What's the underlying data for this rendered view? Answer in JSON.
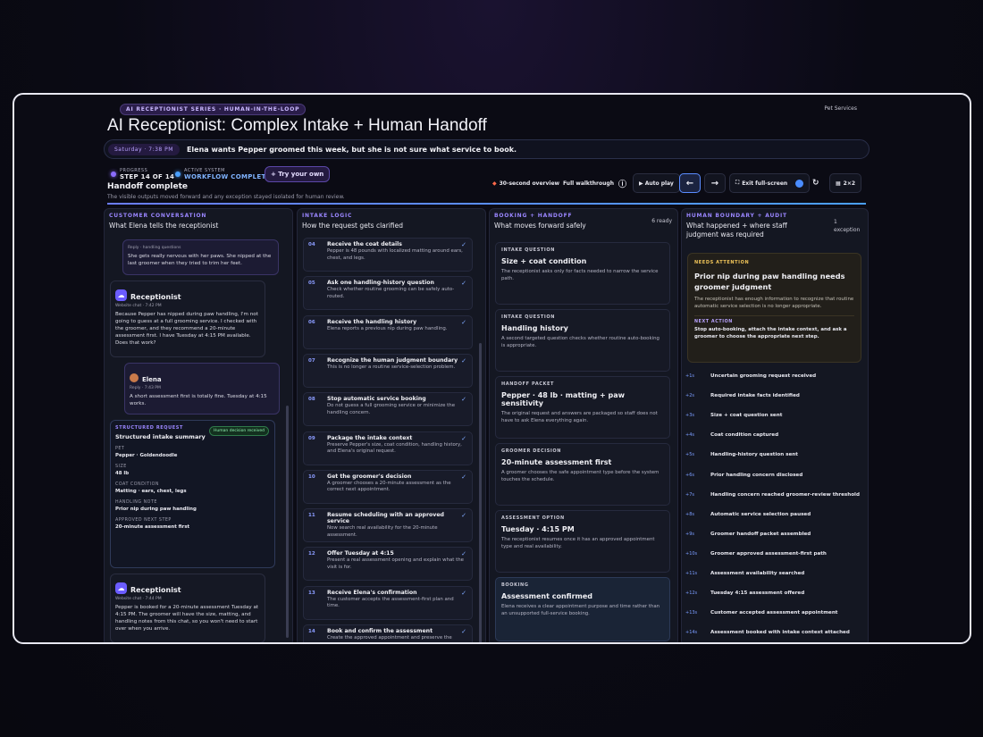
{
  "header": {
    "series": "AI RECEPTIONIST SERIES · HUMAN-IN-THE-LOOP",
    "category": "Pet Services",
    "title": "AI Receptionist: Complex Intake + Human Handoff",
    "scenario_time": "Saturday · 7:38 PM",
    "scenario_text": "Elena wants Pepper groomed this week, but she is not sure what service to book."
  },
  "status": {
    "progress_label": "PROGRESS",
    "progress_value": "STEP 14 OF 14",
    "system_label": "ACTIVE SYSTEM",
    "system_value": "WORKFLOW COMPLETE",
    "try_label": "+ Try your own",
    "headline": "Handoff complete",
    "subline": "The visible outputs moved forward and any exception stayed isolated for human review.",
    "progress_fraction": 1.0
  },
  "toolbar": {
    "overview": "30-second overview",
    "walkthrough": "Full walkthrough",
    "info_icon": "ⓘ",
    "autoplay": "▶ Auto play",
    "prev": "←",
    "next": "→",
    "fullscreen": "Exit full-screen",
    "grid": "2×2"
  },
  "conversation": {
    "heading": "CUSTOMER CONVERSATION",
    "subheading": "What Elena tells the receptionist",
    "msg1_meta": "Reply · handling questions",
    "msg1_text": "She gets really nervous with her paws. She nipped at the last groomer when they tried to trim her feet.",
    "msg2_name": "Receptionist",
    "msg2_meta": "Website chat · 7:42 PM",
    "msg2_text": "Because Pepper has nipped during paw handling, I'm not going to guess at a full grooming service. I checked with the groomer, and they recommend a 20-minute assessment first. I have Tuesday at 4:15 PM available. Does that work?",
    "msg3_name": "Elena",
    "msg3_meta": "Reply · 7:43 PM",
    "msg3_text": "A short assessment first is totally fine. Tuesday at 4:15 works.",
    "sr_label": "STRUCTURED REQUEST",
    "sr_title": "Structured intake summary",
    "sr_badge": "Human decision received",
    "sr_fields": [
      {
        "k": "PET",
        "v": "Pepper · Goldendoodle"
      },
      {
        "k": "SIZE",
        "v": "48 lb"
      },
      {
        "k": "COAT CONDITION",
        "v": "Matting · ears, chest, legs"
      },
      {
        "k": "HANDLING NOTE",
        "v": "Prior nip during paw handling"
      },
      {
        "k": "APPROVED NEXT STEP",
        "v": "20-minute assessment first"
      }
    ],
    "msg4_name": "Receptionist",
    "msg4_meta": "Website chat · 7:44 PM",
    "msg4_text": "Pepper is booked for a 20-minute assessment Tuesday at 4:15 PM. The groomer will have the size, matting, and handling notes from this chat, so you won't need to start over when you arrive."
  },
  "intake": {
    "heading": "INTAKE LOGIC",
    "subheading": "How the request gets clarified",
    "steps": [
      {
        "n": "04",
        "t": "Receive the coat details",
        "d": "Pepper is 48 pounds with localized matting around ears, chest, and legs."
      },
      {
        "n": "05",
        "t": "Ask one handling-history question",
        "d": "Check whether routine grooming can be safely auto-routed."
      },
      {
        "n": "06",
        "t": "Receive the handling history",
        "d": "Elena reports a previous nip during paw handling."
      },
      {
        "n": "07",
        "t": "Recognize the human judgment boundary",
        "d": "This is no longer a routine service-selection problem."
      },
      {
        "n": "08",
        "t": "Stop automatic service booking",
        "d": "Do not guess a full grooming service or minimize the handling concern."
      },
      {
        "n": "09",
        "t": "Package the intake context",
        "d": "Preserve Pepper's size, coat condition, handling history, and Elena's original request."
      },
      {
        "n": "10",
        "t": "Get the groomer's decision",
        "d": "A groomer chooses a 20-minute assessment as the correct next appointment."
      },
      {
        "n": "11",
        "t": "Resume scheduling with an approved service",
        "d": "Now search real availability for the 20-minute assessment."
      },
      {
        "n": "12",
        "t": "Offer Tuesday at 4:15",
        "d": "Present a real assessment opening and explain what the visit is for."
      },
      {
        "n": "13",
        "t": "Receive Elena's confirmation",
        "d": "The customer accepts the assessment-first plan and time."
      },
      {
        "n": "14",
        "t": "Book and confirm the assessment",
        "d": "Create the approved appointment and preserve the intake packet for the groomer."
      }
    ]
  },
  "booking": {
    "heading": "BOOKING + HANDOFF",
    "subheading": "What moves forward safely",
    "count": "6 ready",
    "cards": [
      {
        "k": "INTAKE QUESTION",
        "t": "Size + coat condition",
        "d": "The receptionist asks only for facts needed to narrow the service path."
      },
      {
        "k": "INTAKE QUESTION",
        "t": "Handling history",
        "d": "A second targeted question checks whether routine auto-booking is appropriate."
      },
      {
        "k": "HANDOFF PACKET",
        "t": "Pepper · 48 lb · matting + paw sensitivity",
        "d": "The original request and answers are packaged so staff does not have to ask Elena everything again."
      },
      {
        "k": "GROOMER DECISION",
        "t": "20-minute assessment first",
        "d": "A groomer chooses the safe appointment type before the system touches the schedule."
      },
      {
        "k": "ASSESSMENT OPTION",
        "t": "Tuesday · 4:15 PM",
        "d": "The receptionist resumes once it has an approved appointment type and real availability."
      },
      {
        "k": "BOOKING",
        "t": "Assessment confirmed",
        "d": "Elena receives a clear appointment purpose and time rather than an unsupported full-service booking."
      }
    ]
  },
  "audit": {
    "heading": "HUMAN BOUNDARY + AUDIT",
    "subheading": "What happened + where staff judgment was required",
    "count": "1 exception",
    "attn_label": "NEEDS ATTENTION",
    "attn_title": "Prior nip during paw handling needs groomer judgment",
    "attn_text": "The receptionist has enough information to recognize that routine automatic service selection is no longer appropriate.",
    "next_label": "NEXT ACTION",
    "next_text": "Stop auto-booking, attach the intake context, and ask a groomer to choose the appropriate next step.",
    "log": [
      {
        "ts": "+1s",
        "ev": "Uncertain grooming request received"
      },
      {
        "ts": "+2s",
        "ev": "Required intake facts identified"
      },
      {
        "ts": "+3s",
        "ev": "Size + coat question sent"
      },
      {
        "ts": "+4s",
        "ev": "Coat condition captured"
      },
      {
        "ts": "+5s",
        "ev": "Handling-history question sent"
      },
      {
        "ts": "+6s",
        "ev": "Prior handling concern disclosed"
      },
      {
        "ts": "+7s",
        "ev": "Handling concern reached groomer-review threshold"
      },
      {
        "ts": "+8s",
        "ev": "Automatic service selection paused"
      },
      {
        "ts": "+9s",
        "ev": "Groomer handoff packet assembled"
      },
      {
        "ts": "+10s",
        "ev": "Groomer approved assessment-first path"
      },
      {
        "ts": "+11s",
        "ev": "Assessment availability searched"
      },
      {
        "ts": "+12s",
        "ev": "Tuesday 4:15 assessment offered"
      },
      {
        "ts": "+13s",
        "ev": "Customer accepted assessment appointment"
      },
      {
        "ts": "+14s",
        "ev": "Assessment booked with intake context attached"
      }
    ]
  }
}
